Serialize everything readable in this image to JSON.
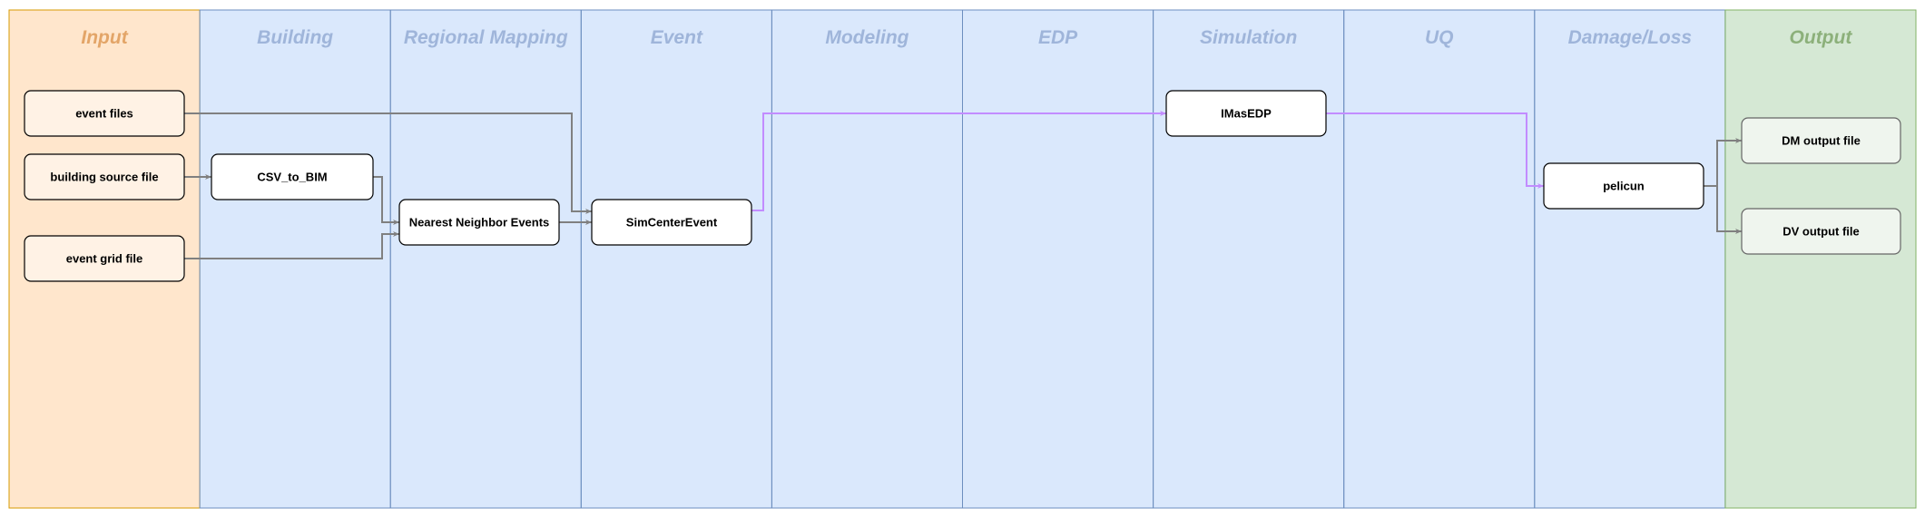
{
  "lanes": [
    {
      "title": "Input",
      "kind": "input"
    },
    {
      "title": "Building",
      "kind": "stage"
    },
    {
      "title": "Regional Mapping",
      "kind": "stage"
    },
    {
      "title": "Event",
      "kind": "stage"
    },
    {
      "title": "Modeling",
      "kind": "stage"
    },
    {
      "title": "EDP",
      "kind": "stage"
    },
    {
      "title": "Simulation",
      "kind": "stage"
    },
    {
      "title": "UQ",
      "kind": "stage"
    },
    {
      "title": "Damage/Loss",
      "kind": "stage"
    },
    {
      "title": "Output",
      "kind": "output"
    }
  ],
  "nodes": {
    "event_files": "event files",
    "building_source_file": "building source file",
    "event_grid_file": "event grid file",
    "csv_to_bim": "CSV_to_BIM",
    "nearest_neighbor": "Nearest Neighbor Events",
    "simcenter_event": "SimCenterEvent",
    "imasedp": "IMasEDP",
    "pelicun": "pelicun",
    "dm_output": "DM output file",
    "dv_output": "DV output file"
  },
  "colors": {
    "input_fill": "#ffe6cc",
    "input_stroke": "#d79b00",
    "input_title": "#e3a568",
    "stage_fill": "#dae8fc",
    "stage_stroke": "#6c8ebf",
    "stage_title": "#9fb5da",
    "output_fill": "#d5e8d4",
    "output_stroke": "#82b366",
    "output_title": "#8cb07a",
    "input_box": "#fff2e5",
    "output_box": "#eff5ee",
    "process_box": "#ffffff",
    "edge": "#808080",
    "edge_highlight": "#c28cff"
  }
}
